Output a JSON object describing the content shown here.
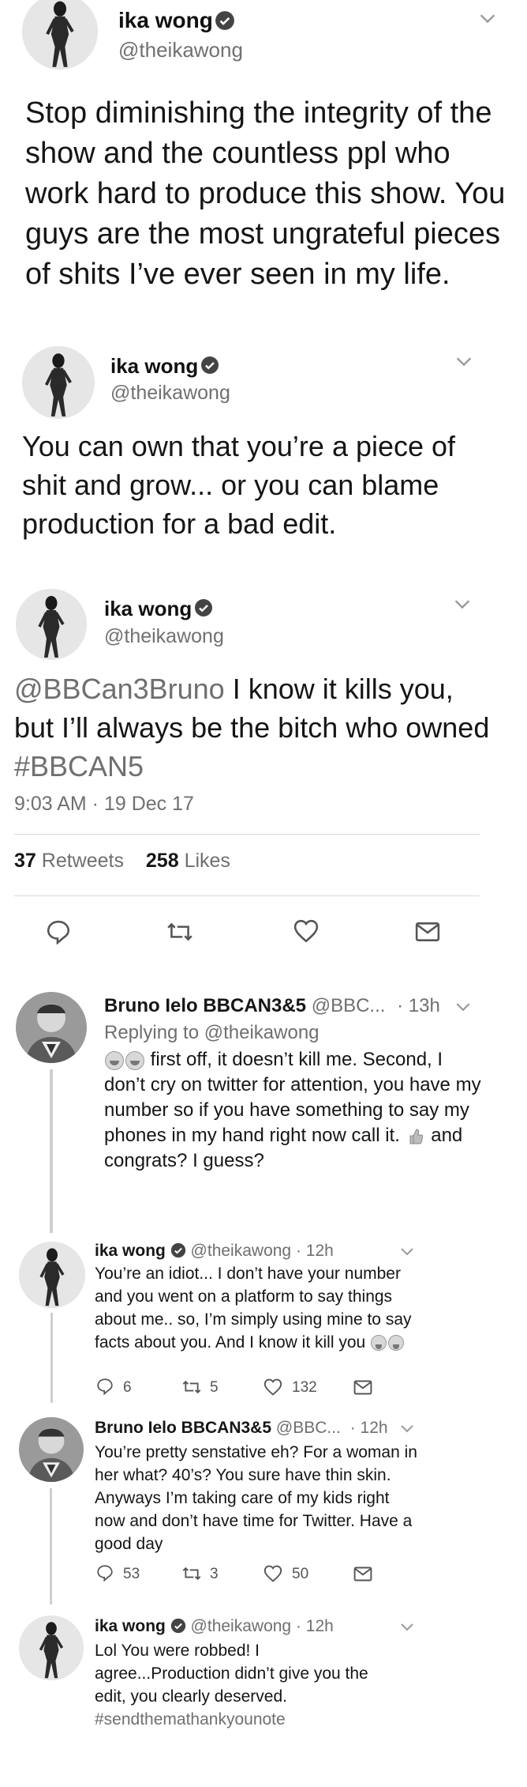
{
  "tweet1": {
    "name": "ika wong",
    "handle": "@theikawong",
    "text": "Stop diminishing the integrity of the show and the countless ppl who work hard to produce this show.  You guys are the most ungrateful pieces of shits I’ve ever seen in my life."
  },
  "tweet2": {
    "name": "ika wong",
    "handle": "@theikawong",
    "text": "You can own that you’re a piece of shit and grow... or you can blame production for a bad edit."
  },
  "tweet3": {
    "name": "ika wong",
    "handle": "@theikawong",
    "mention": "@BBCan3Bruno",
    "text_mid": " I know it kills you, but I’ll always be the bitch who owned ",
    "hashtag": "#BBCAN5",
    "timestamp": "9:03 AM · 19 Dec 17",
    "retweets_count": "37",
    "retweets_label": "Retweets",
    "likes_count": "258",
    "likes_label": "Likes"
  },
  "reply1": {
    "name": "Bruno Ielo BBCAN3&5",
    "handle": "@BBC...",
    "time": "· 13h",
    "replying_label": "Replying to",
    "replying_to": "@theikawong",
    "text_a": "first off, it doesn’t kill me. Second, I don’t cry on twitter for attention, you have my number so if you have something to say my phones in my hand right now call it.",
    "text_b": "and congrats? I guess?"
  },
  "reply2": {
    "name": "ika wong",
    "handle": "@theikawong · 12h",
    "text": "You’re an idiot... I don’t have your number and you went on a platform to say things about me.. so, I’m simply using mine to say facts about you.  And I know it kill you",
    "replies": "6",
    "retweets": "5",
    "likes": "132"
  },
  "reply3": {
    "name": "Bruno Ielo BBCAN3&5",
    "handle": "@BBC...",
    "time": "· 12h",
    "text": "You’re pretty senstative eh? For a woman in her what? 40’s? You sure have thin skin. Anyways I’m taking care of my kids right now and don’t have time for Twitter. Have a good day",
    "replies": "53",
    "retweets": "3",
    "likes": "50"
  },
  "reply4": {
    "name": "ika wong",
    "handle": "@theikawong · 12h",
    "text": "Lol You were robbed! I agree...Production didn’t give you the edit, you clearly deserved.",
    "hashtag": "#sendthemathankyounote"
  },
  "icons": [
    "verified-icon",
    "chevron-down-icon",
    "reply-icon",
    "retweet-icon",
    "heart-icon",
    "mail-icon",
    "laughing-emoji-icon",
    "thumbs-up-icon"
  ]
}
